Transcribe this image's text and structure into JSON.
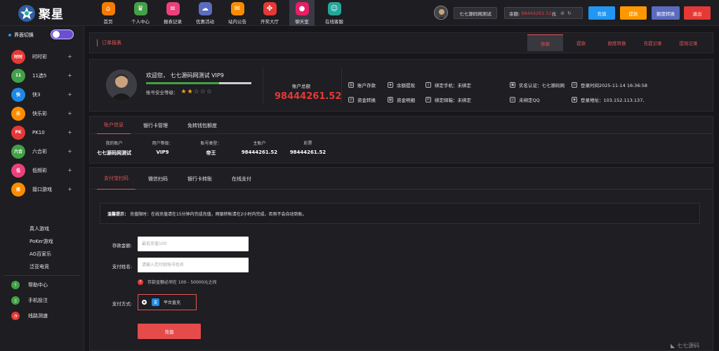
{
  "app": {
    "logo_text": "聚星"
  },
  "nav": [
    {
      "label": "首页",
      "icon": "home-icon",
      "color": "#f57c00"
    },
    {
      "label": "个人中心",
      "icon": "crown-icon",
      "color": "#43a047"
    },
    {
      "label": "报表记录",
      "icon": "report-icon",
      "color": "#ec407a"
    },
    {
      "label": "优惠活动",
      "icon": "gift-icon",
      "color": "#5c6bc0"
    },
    {
      "label": "站内公告",
      "icon": "mail-icon",
      "color": "#fb8c00"
    },
    {
      "label": "开奖大厅",
      "icon": "grid-icon",
      "color": "#e53935"
    },
    {
      "label": "聊天室",
      "icon": "chat-icon",
      "color": "#e91e63",
      "active": true
    },
    {
      "label": "在线客服",
      "icon": "service-icon",
      "color": "#26a69a"
    }
  ],
  "topbar": {
    "username": "七七源码网测试",
    "balance_label": "余额:",
    "balance_value": "98444261.52",
    "balance_unit": "元",
    "recharge": "充值",
    "withdraw": "提款",
    "convert": "额度转换",
    "logout": "退出"
  },
  "sidebar": {
    "switch_label": "界面切换",
    "games": [
      {
        "label": "时时彩",
        "icon": "ssc-icon",
        "badge": "时时",
        "color": "#e53935"
      },
      {
        "label": "11选5",
        "icon": "eleven-five-icon",
        "badge": "11",
        "color": "#43a047"
      },
      {
        "label": "快3",
        "icon": "dice-icon",
        "badge": "快",
        "color": "#1e88e5"
      },
      {
        "label": "快乐彩",
        "icon": "happy-icon",
        "badge": "乐",
        "color": "#fb8c00"
      },
      {
        "label": "PK10",
        "icon": "pk10-icon",
        "badge": "PK",
        "color": "#e53935"
      },
      {
        "label": "六合彩",
        "icon": "mark-six-icon",
        "badge": "六合",
        "color": "#43a047"
      },
      {
        "label": "低频彩",
        "icon": "lowfreq-icon",
        "badge": "低",
        "color": "#ec407a"
      },
      {
        "label": "接口游戏",
        "icon": "api-game-icon",
        "badge": "接",
        "color": "#fb8c00"
      }
    ],
    "sub_items": [
      "真人游戏",
      "PoKer游戏",
      "AG百家乐",
      "泛亚电竞"
    ],
    "help": [
      {
        "label": "帮助中心",
        "icon": "help-icon",
        "color": "#43a047"
      },
      {
        "label": "手机投注",
        "icon": "mobile-icon",
        "color": "#43a047"
      },
      {
        "label": "线路测速",
        "icon": "speed-icon",
        "color": "#e53935"
      }
    ]
  },
  "header": {
    "title": "订单报表",
    "tabs": [
      "存款",
      "提款",
      "额度转换",
      "充提记录",
      "提现记录"
    ]
  },
  "info": {
    "welcome": "欢迎您， 七七源码网测试 VIP9",
    "safety_label": "账号安全等级：",
    "stars_on": 2,
    "stars_total": 5,
    "progress": 0.69,
    "total_label": "账户总额",
    "total_value": "98444261.52",
    "links": {
      "deposit": "账户存款",
      "balance": "余额提现",
      "transfer": "资金转换",
      "detail": "资金明细",
      "phone": "绑定手机：未绑定",
      "email": "绑定邮箱：未绑定",
      "realname": "实名认证：七七源码网",
      "qq": "未绑定QQ",
      "login_time": "登录时间2025-11-14 16:36:58",
      "login_ip": "登录地址：103.152.113.137,"
    }
  },
  "account": {
    "tabs": [
      "账户信息",
      "银行卡管理",
      "免转钱包额度"
    ],
    "cells": [
      {
        "k": "我的账户",
        "v": "七七源码网测试"
      },
      {
        "k": "用户等级：",
        "v": "VIP9"
      },
      {
        "k": "账号类型：",
        "v": "帝王"
      },
      {
        "k": "主账户",
        "v": "98444261.52"
      },
      {
        "k": "彩票",
        "v": "98444261.52"
      }
    ]
  },
  "payment": {
    "tabs": [
      "支付宝扫码",
      "微信扫码",
      "银行卡转账",
      "在线支付"
    ],
    "notice_bold": "温馨提示：",
    "notice_text": "充值限时：在线充值请在15分钟内完成充值，网银转帐请在2小时内完成，否则不会自动到账。",
    "amount_label": "存款金额:",
    "amount_placeholder": "最低充值100",
    "name_label": "支付姓名:",
    "name_placeholder": "请输入您付款账号姓名",
    "hint": "存款金额必须在 100 - 50000元之间",
    "method_label": "支付方式:",
    "method_name": "平台直充",
    "submit": "充值"
  },
  "watermark": "七七源码"
}
